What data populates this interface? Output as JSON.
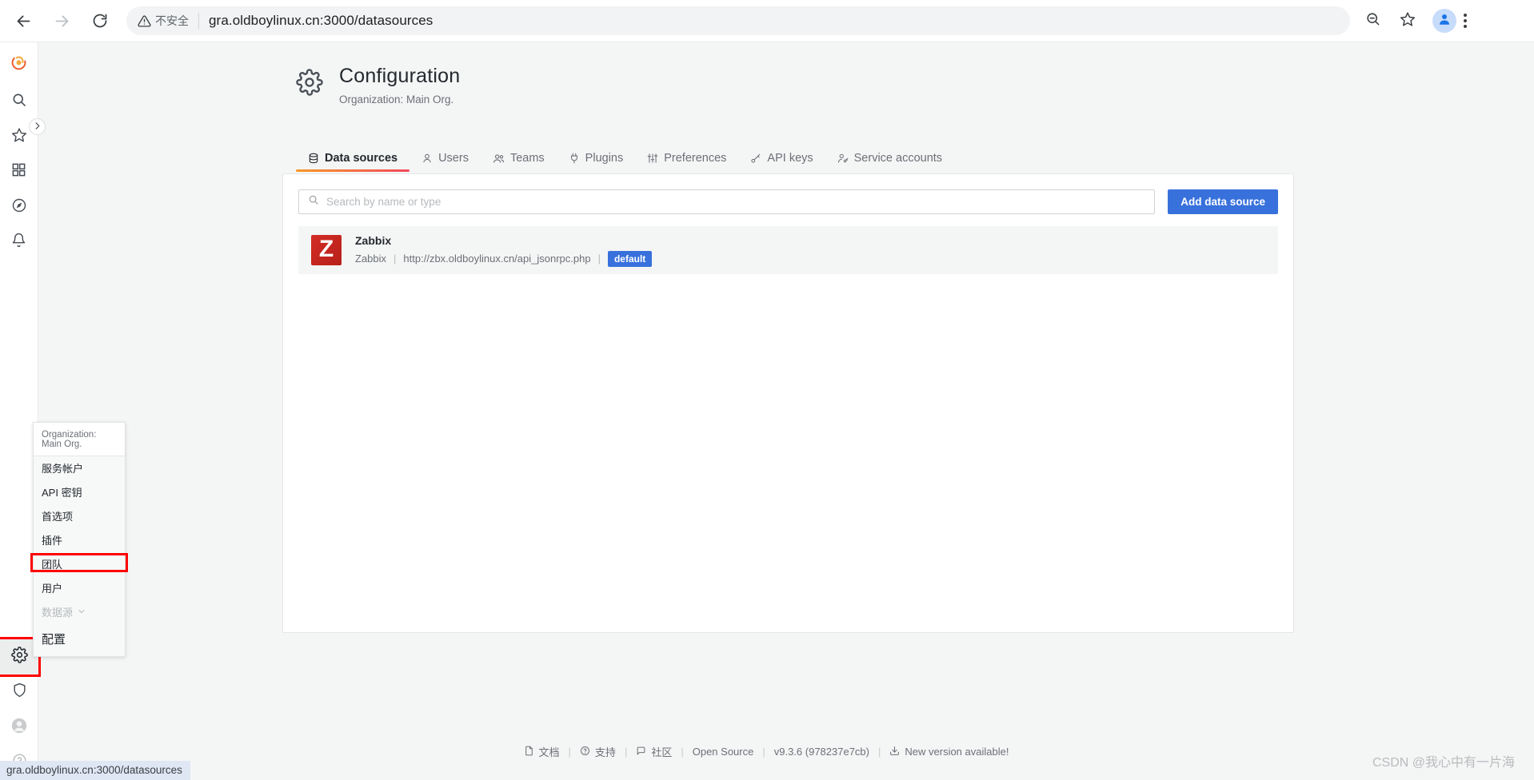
{
  "browser": {
    "security_label": "不安全",
    "url": "gra.oldboylinux.cn:3000/datasources",
    "icons": {
      "back": "back-arrow-icon",
      "forward": "forward-arrow-icon",
      "reload": "reload-icon",
      "warning": "warning-triangle-icon",
      "zoom_out": "zoom-out-icon",
      "bookmark": "star-icon",
      "profile": "profile-avatar-icon",
      "menu": "kebab-menu-icon"
    }
  },
  "status_bar": {
    "url": "gra.oldboylinux.cn:3000/datasources"
  },
  "sidebar": {
    "items": [
      {
        "name": "grafana-logo",
        "icon": "grafana-logo-icon"
      },
      {
        "name": "search",
        "icon": "search-icon"
      },
      {
        "name": "starred",
        "icon": "star-icon"
      },
      {
        "name": "dashboards",
        "icon": "grid-icon"
      },
      {
        "name": "explore",
        "icon": "compass-icon"
      },
      {
        "name": "alerting",
        "icon": "bell-icon"
      }
    ],
    "bottom_items": [
      {
        "name": "configuration",
        "icon": "gear-icon",
        "active": true
      },
      {
        "name": "server-admin",
        "icon": "shield-icon"
      },
      {
        "name": "user-profile",
        "icon": "user-avatar-icon"
      },
      {
        "name": "help",
        "icon": "question-circle-icon"
      }
    ],
    "expand_icon": "chevron-right-icon"
  },
  "header": {
    "icon": "gear-icon",
    "title": "Configuration",
    "subtitle": "Organization: Main Org."
  },
  "tabs": [
    {
      "label": "Data sources",
      "icon": "database-icon",
      "active": true
    },
    {
      "label": "Users",
      "icon": "user-icon",
      "active": false
    },
    {
      "label": "Teams",
      "icon": "users-icon",
      "active": false
    },
    {
      "label": "Plugins",
      "icon": "plug-icon",
      "active": false
    },
    {
      "label": "Preferences",
      "icon": "sliders-icon",
      "active": false
    },
    {
      "label": "API keys",
      "icon": "key-icon",
      "active": false
    },
    {
      "label": "Service accounts",
      "icon": "user-key-icon",
      "active": false
    }
  ],
  "toolbar": {
    "search_placeholder": "Search by name or type",
    "search_value": "",
    "search_icon": "search-icon",
    "add_button": "Add data source"
  },
  "datasources": [
    {
      "logo_letter": "Z",
      "name": "Zabbix",
      "type": "Zabbix",
      "url": "http://zbx.oldboylinux.cn/api_jsonrpc.php",
      "badge": "default"
    }
  ],
  "context_menu": {
    "header": "Organization: Main Org.",
    "items": [
      {
        "label": "服务帐户",
        "state": "normal"
      },
      {
        "label": "API 密钥",
        "state": "normal"
      },
      {
        "label": "首选项",
        "state": "normal"
      },
      {
        "label": "插件",
        "state": "normal"
      },
      {
        "label": "团队",
        "state": "normal"
      },
      {
        "label": "用户",
        "state": "normal"
      },
      {
        "label": "数据源",
        "state": "dim",
        "chevron": "chevron-down-icon"
      },
      {
        "label": "配置",
        "state": "big"
      }
    ],
    "highlight_color": "#ff0000"
  },
  "footer": {
    "items": [
      {
        "label": "文档",
        "icon": "doc-icon"
      },
      {
        "label": "支持",
        "icon": "question-circle-icon"
      },
      {
        "label": "社区",
        "icon": "comments-icon"
      },
      {
        "label": "Open Source",
        "icon": ""
      },
      {
        "label": "v9.3.6 (978237e7cb)",
        "icon": ""
      },
      {
        "label": "New version available!",
        "icon": "download-icon"
      }
    ],
    "separator": "|"
  },
  "watermark": "CSDN @我心中有一片海",
  "colors": {
    "accent_blue": "#3871dc",
    "tab_gradient_start": "#f89827",
    "tab_gradient_end": "#f2495c",
    "zabbix_red": "#d32d25",
    "page_bg": "#f4f5f5",
    "highlight_red": "#ff0000"
  }
}
